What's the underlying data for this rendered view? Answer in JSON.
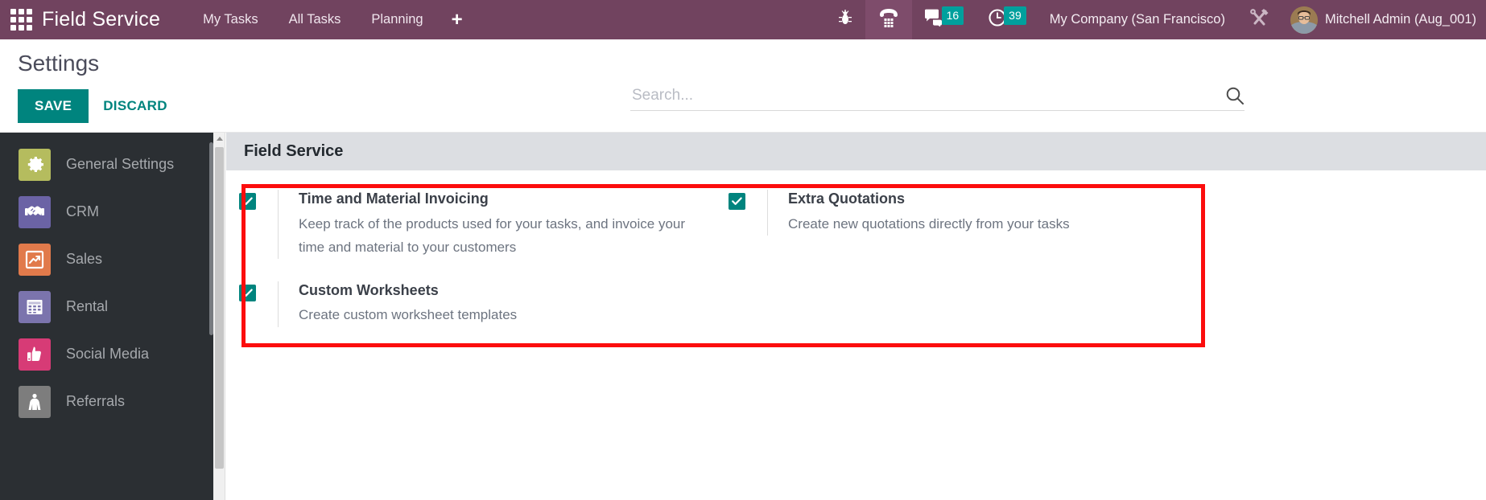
{
  "navbar": {
    "apps_icon": "apps-grid-icon",
    "brand": "Field Service",
    "menu": [
      {
        "label": "My Tasks",
        "name": "menu-my-tasks"
      },
      {
        "label": "All Tasks",
        "name": "menu-all-tasks"
      },
      {
        "label": "Planning",
        "name": "menu-planning"
      }
    ],
    "add_label": "+",
    "icons": [
      {
        "name": "bug-icon",
        "label": "bug"
      },
      {
        "name": "phone-dialpad-icon",
        "label": "phone"
      }
    ],
    "messages": {
      "icon": "chat-bubble-icon",
      "count": "16"
    },
    "activities": {
      "icon": "clock-icon",
      "count": "39"
    },
    "company": "My Company (San Francisco)",
    "debug_icon": "wrench-screwdriver-icon",
    "user": "Mitchell Admin (Aug_001)",
    "avatar": "user-avatar"
  },
  "control_panel": {
    "title": "Settings",
    "save_label": "SAVE",
    "discard_label": "DISCARD",
    "search_placeholder": "Search...",
    "search_value": "",
    "search_icon": "search-icon"
  },
  "sidebar": {
    "items": [
      {
        "label": "General Settings",
        "icon": "gear-icon",
        "color": "#b5bc5e"
      },
      {
        "label": "CRM",
        "icon": "handshake-icon",
        "color": "#6b63a5"
      },
      {
        "label": "Sales",
        "icon": "chart-up-icon",
        "color": "#e17a4b"
      },
      {
        "label": "Rental",
        "icon": "calendar-icon",
        "color": "#7b74ad"
      },
      {
        "label": "Social Media",
        "icon": "thumbs-up-icon",
        "color": "#d73b76"
      },
      {
        "label": "Referrals",
        "icon": "person-cape-icon",
        "color": "#7d7d7d"
      }
    ]
  },
  "main": {
    "section_title": "Field Service",
    "settings": {
      "left": [
        {
          "title": "Time and Material Invoicing",
          "desc": "Keep track of the products used for your tasks, and invoice your time and material to your customers",
          "checked": true
        },
        {
          "title": "Custom Worksheets",
          "desc": "Create custom worksheet templates",
          "checked": true
        }
      ],
      "right": [
        {
          "title": "Extra Quotations",
          "desc": "Create new quotations directly from your tasks",
          "checked": true
        }
      ]
    },
    "highlight_color": "#fc0d0d"
  },
  "theme": {
    "navbar_bg": "#71435f",
    "accent": "#00847e",
    "badge": "#00a09d",
    "sidebar_bg": "#2b2f33",
    "section_header_bg": "#dcdee2"
  }
}
